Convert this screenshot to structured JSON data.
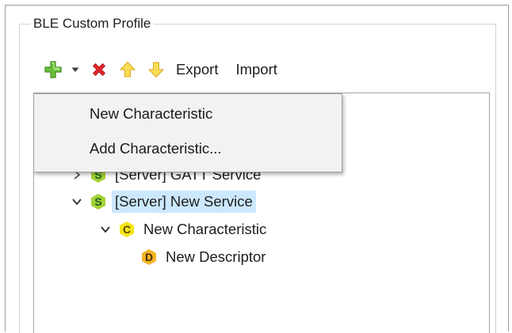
{
  "group": {
    "title": "BLE Custom Profile"
  },
  "toolbar": {
    "add_icon": "green-plus-icon",
    "dropdown_icon": "dropdown-arrow-icon",
    "delete_icon": "red-x-delete-icon",
    "move_up_icon": "arrow-up-icon",
    "move_down_icon": "arrow-down-icon",
    "export_label": "Export",
    "import_label": "Import"
  },
  "tree": {
    "nodes": [
      {
        "badge": "S",
        "label": "[Server] GATT Service",
        "expanded": false,
        "selected": false
      },
      {
        "badge": "S",
        "label": "[Server] New Service",
        "expanded": true,
        "selected": true
      },
      {
        "badge": "C",
        "label": "New Characteristic",
        "expanded": true,
        "selected": false
      },
      {
        "badge": "D",
        "label": "New Descriptor",
        "expanded": false,
        "selected": false
      }
    ]
  },
  "menu": {
    "items": [
      {
        "label": "New Characteristic"
      },
      {
        "label": "Add Characteristic..."
      }
    ]
  },
  "colors": {
    "service_badge": "#a5d235",
    "characteristic_badge": "#f5e51a",
    "descriptor_badge": "#f4b324",
    "selection": "#cce8ff",
    "delete_red": "#e0282e",
    "add_green": "#6cbf3a",
    "arrow_yellow": "#f3cf3a"
  }
}
